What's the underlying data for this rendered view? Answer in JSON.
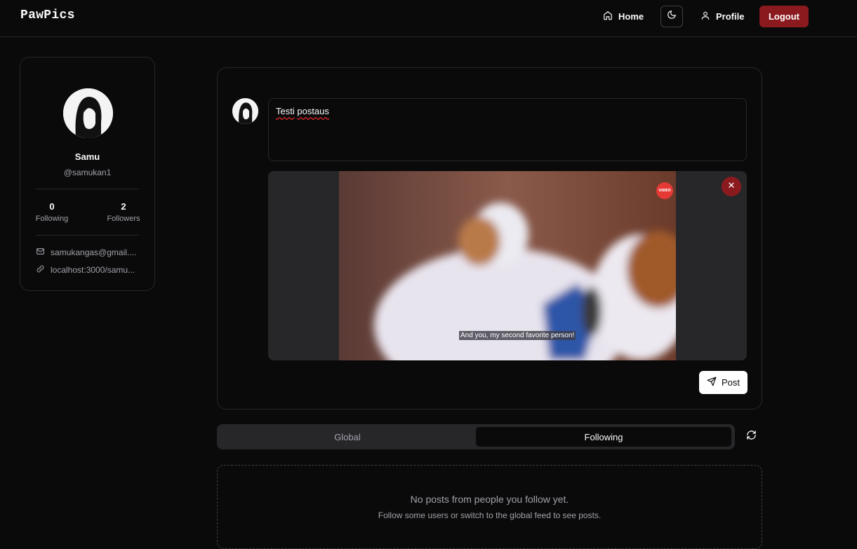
{
  "header": {
    "brand": "PawPics",
    "home_label": "Home",
    "profile_label": "Profile",
    "logout_label": "Logout"
  },
  "profile": {
    "name": "Samu",
    "handle": "@samukan1",
    "stats": [
      {
        "value": "0",
        "label": "Following"
      },
      {
        "value": "2",
        "label": "Followers"
      }
    ],
    "email": "samukangas@gmail....",
    "link": "localhost:3000/samu..."
  },
  "composer": {
    "text_part1": "Testi",
    "text_part2": "postaus",
    "video_caption": "And you, my second favorite person!",
    "video_badge": "VIDEO",
    "post_label": "Post"
  },
  "tabs": {
    "items": [
      {
        "label": "Global",
        "active": false
      },
      {
        "label": "Following",
        "active": true
      }
    ]
  },
  "empty_state": {
    "title": "No posts from people you follow yet.",
    "subtitle": "Follow some users or switch to the global feed to see posts."
  },
  "colors": {
    "background": "#0a0a0a",
    "border": "#27272a",
    "accent_red": "#8b1a1f",
    "muted_text": "#a1a1aa"
  },
  "icons": {
    "home": "home-icon",
    "theme": "moon-icon",
    "profile": "user-icon",
    "email": "mail-icon",
    "link": "link-icon",
    "close": "close-icon",
    "post": "send-icon",
    "refresh": "refresh-icon"
  }
}
